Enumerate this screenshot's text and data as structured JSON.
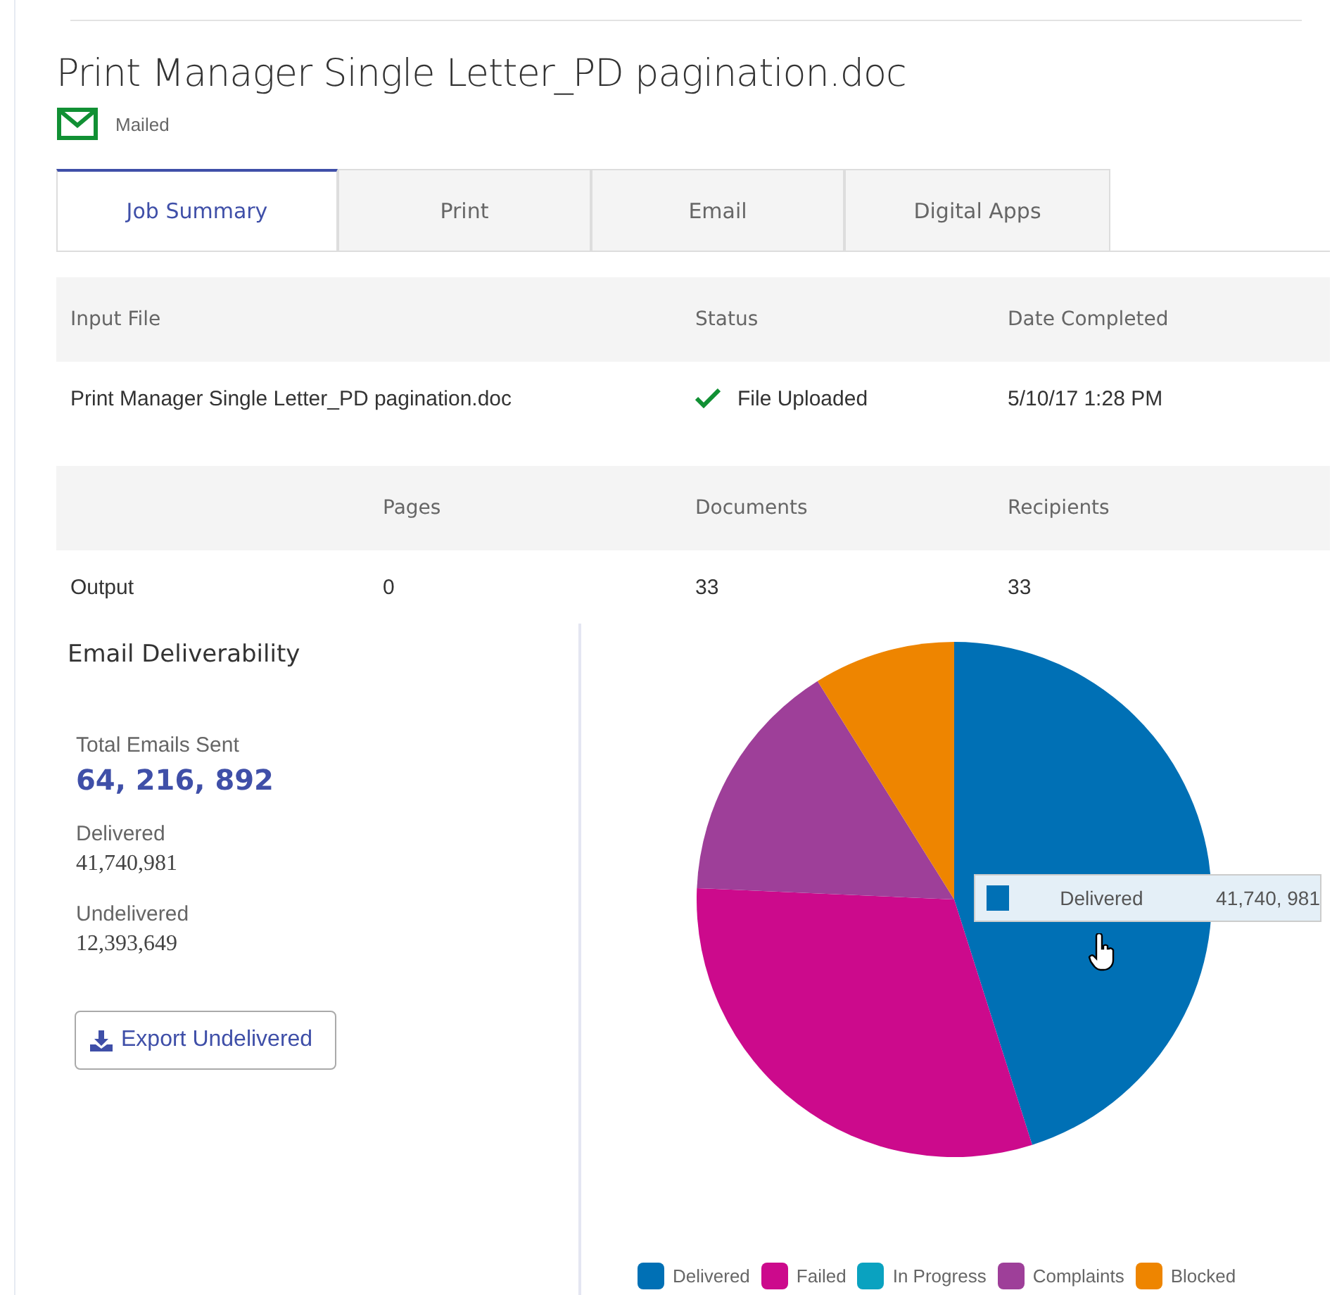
{
  "document": {
    "title": "Print Manager Single Letter_PD pagination.doc",
    "status": "Mailed"
  },
  "tabs": [
    {
      "label": "Job Summary",
      "selected": true
    },
    {
      "label": "Print",
      "selected": false
    },
    {
      "label": "Email",
      "selected": false
    },
    {
      "label": "Digital Apps",
      "selected": false
    }
  ],
  "input_table": {
    "columns": [
      "Input File",
      "Status",
      "Date Completed"
    ],
    "row": {
      "file": "Print Manager Single Letter_PD pagination.doc",
      "status": "File Uploaded",
      "date": "5/10/17 1:28 PM"
    }
  },
  "output_table": {
    "columns": [
      "Pages",
      "Documents",
      "Recipients"
    ],
    "row": {
      "label": "Output",
      "values": [
        "0",
        "33",
        "33"
      ]
    }
  },
  "deliverability": {
    "title": "Email Deliverability",
    "total_label": "Total Emails Sent",
    "total": "64, 216, 892",
    "stats": [
      {
        "label": "Delivered",
        "value": "41,740,981"
      },
      {
        "label": "Undelivered",
        "value": "12,393,649"
      }
    ],
    "export_button": "Export Undelivered"
  },
  "pie": {
    "tooltip": {
      "label": "Delivered",
      "value": "41,740, 981",
      "color": "#0070b5"
    },
    "legend": [
      {
        "label": "Delivered",
        "color": "#0070b5"
      },
      {
        "label": "Failed",
        "color": "#cc0a8c"
      },
      {
        "label": "In Progress",
        "color": "#0aa2c0"
      },
      {
        "label": "Complaints",
        "color": "#9e3f99"
      },
      {
        "label": "Blocked",
        "color": "#ee8500"
      }
    ]
  }
}
